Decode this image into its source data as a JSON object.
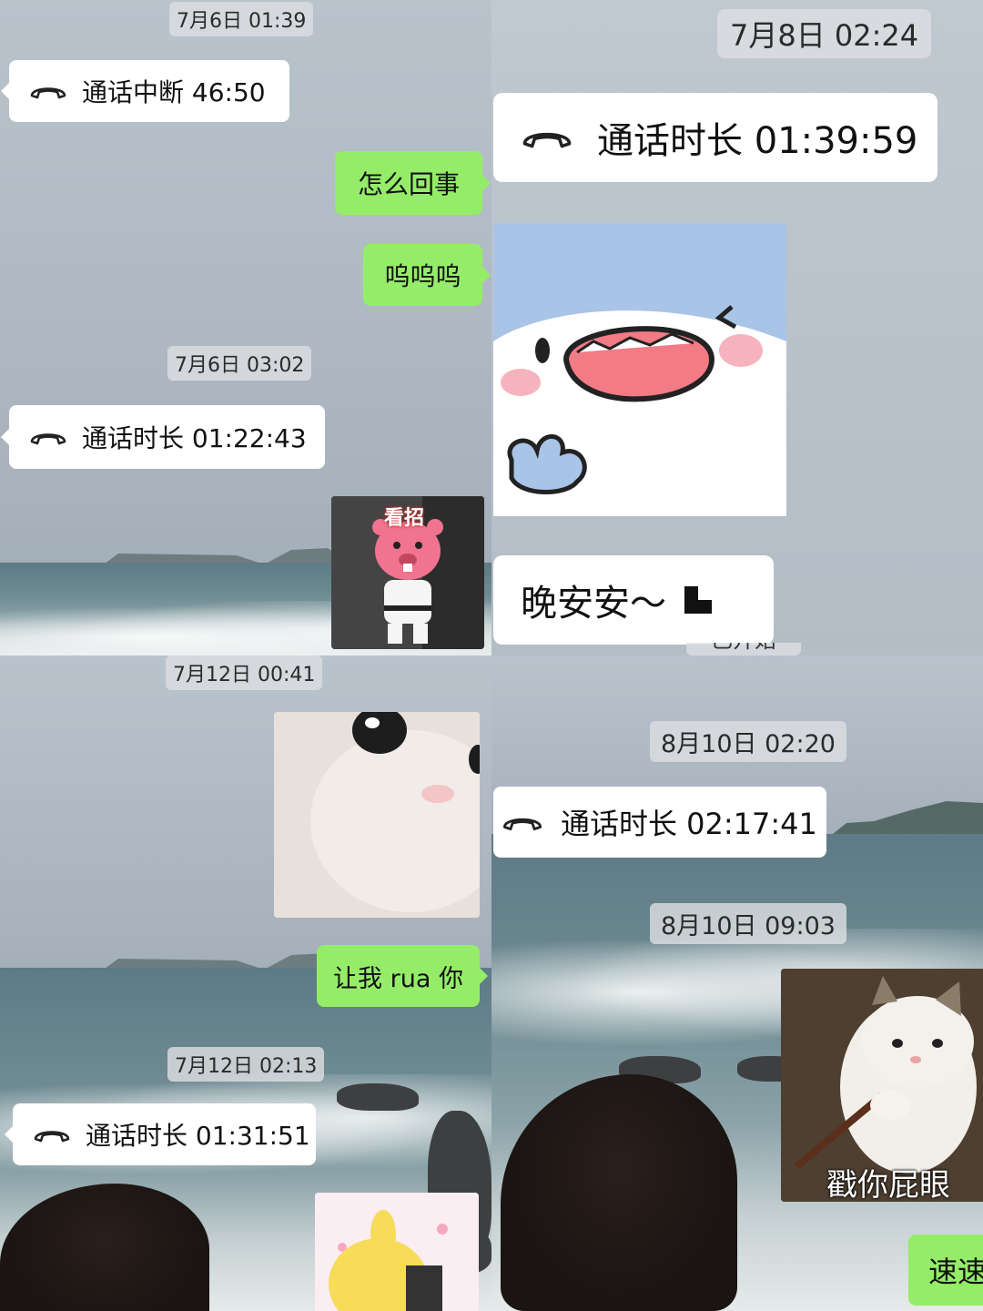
{
  "panel1": {
    "timestamp1": "7月6日 01:39",
    "call1": "通话中断 46:50",
    "msg1": "怎么回事",
    "msg2": "呜呜呜",
    "timestamp2": "7月6日 03:02",
    "call2": "通话时长 01:22:43",
    "sticker_caption": "看招"
  },
  "panel2": {
    "timestamp1": "7月8日 02:24",
    "call1": "通话时长 01:39:59",
    "msg1": "晚安安～",
    "partial_system_text": "已开始"
  },
  "panel3": {
    "timestamp1": "7月12日 00:41",
    "msg1": "让我 rua 你",
    "timestamp2": "7月12日 02:13",
    "call1": "通话时长 01:31:51"
  },
  "panel4": {
    "timestamp1": "8月10日 02:20",
    "call1": "通话时长 02:17:41",
    "timestamp2": "8月10日 09:03",
    "sticker_caption": "戳你屁眼",
    "partial_msg": "速速"
  },
  "icons": [
    "phone-handset-icon"
  ],
  "colors": {
    "green_bubble": "#95ec69",
    "white_bubble": "#ffffff",
    "timestamp_bg": "#dcdee0"
  }
}
